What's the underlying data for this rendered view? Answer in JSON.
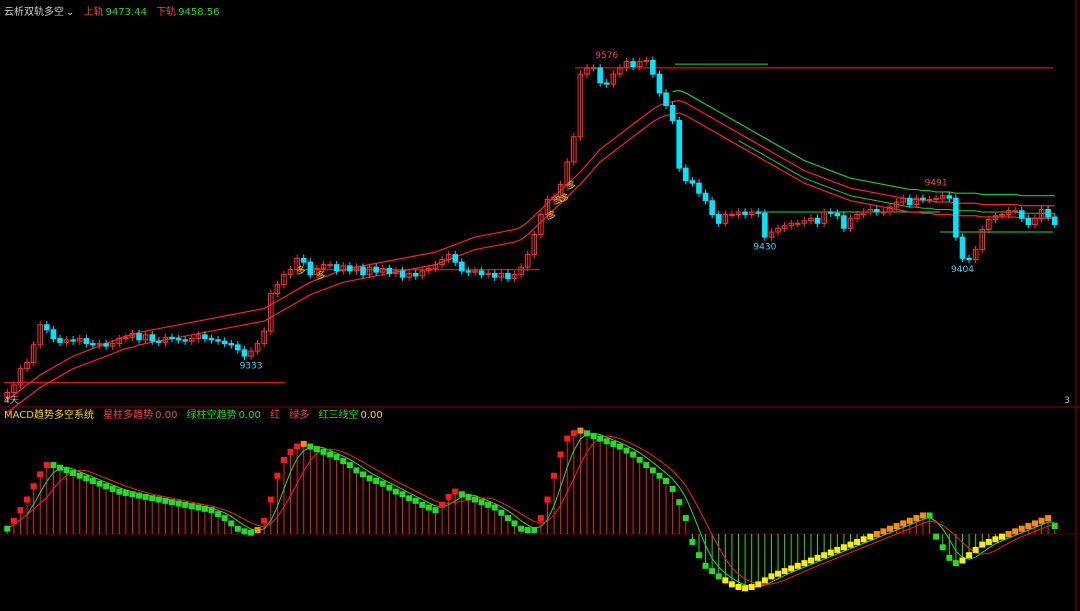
{
  "header": {
    "indicator_name": "云析双轨多空",
    "dropdown_icon": "chevron-down-icon",
    "upper_label": "上轨",
    "upper_value": "9473.44",
    "lower_label": "下轨",
    "lower_value": "9458.56"
  },
  "macd_header": {
    "name": "MACD趋势多空系统",
    "items": [
      {
        "label": "星柱多趋势",
        "value": "0.00"
      },
      {
        "label": "绿柱空趋势",
        "value": "0.00"
      },
      {
        "label": "红",
        "value": ""
      },
      {
        "label": "绿多",
        "value": ""
      },
      {
        "label": "红三线空",
        "value": "0.00"
      }
    ]
  },
  "axis": {
    "left_label": "4天",
    "right_label": "3"
  },
  "colors": {
    "background": "#000000",
    "frame": "#8b0000",
    "up_candle": "#ff3030",
    "down_candle": "#00e5ff",
    "ma_line": "#ff2020",
    "band_line": "#22c822",
    "level_line": "#e01010",
    "green_level": "#22dd22",
    "label_cyan": "#39d3ff",
    "label_red": "#ff4040",
    "signal_yellow": "#ffd700",
    "macd_red": "#ff1a1a",
    "macd_orange": "#ff8c00",
    "macd_yellow": "#ffee00",
    "macd_green": "#22dd22"
  },
  "chart_data": [
    {
      "type": "candlestick",
      "title": "云析双轨多空",
      "x": [
        1,
        2,
        3,
        4,
        5,
        6,
        7,
        8,
        9,
        10,
        11,
        12,
        13,
        14,
        15,
        16,
        17,
        18,
        19,
        20,
        21,
        22,
        23,
        24,
        25,
        26,
        27,
        28,
        29,
        30,
        31,
        32,
        33,
        34,
        35,
        36,
        37,
        38,
        39,
        40,
        41,
        42,
        43,
        44,
        45,
        46,
        47,
        48,
        49,
        50,
        51,
        52,
        53,
        54,
        55,
        56,
        57,
        58,
        59,
        60,
        61,
        62,
        63,
        64,
        65,
        66,
        67,
        68,
        69,
        70,
        71,
        72,
        73,
        74,
        75,
        76,
        77,
        78,
        79,
        80,
        81,
        82,
        83,
        84,
        85,
        86,
        87,
        88,
        89,
        90,
        91,
        92,
        93,
        94,
        95,
        96,
        97,
        98,
        99,
        100,
        101,
        102,
        103,
        104,
        105,
        106,
        107,
        108,
        109,
        110,
        111,
        112,
        113,
        114,
        115,
        116,
        117,
        118,
        119,
        120,
        121,
        122,
        123,
        124,
        125,
        126,
        127,
        128,
        129,
        130,
        131,
        132,
        133,
        134,
        135,
        136,
        137,
        138,
        139,
        140,
        141,
        142,
        143,
        144,
        145,
        146,
        147,
        148,
        149,
        150,
        151,
        152,
        153,
        154,
        155,
        156,
        157,
        158,
        159,
        160
      ],
      "close": [
        9306,
        9312,
        9325,
        9330,
        9344,
        9360,
        9356,
        9349,
        9346,
        9348,
        9347,
        9349,
        9345,
        9344,
        9345,
        9343,
        9345,
        9349,
        9350,
        9353,
        9348,
        9352,
        9347,
        9346,
        9350,
        9349,
        9348,
        9347,
        9349,
        9352,
        9349,
        9348,
        9347,
        9345,
        9344,
        9340,
        9335,
        9339,
        9345,
        9355,
        9385,
        9392,
        9400,
        9404,
        9413,
        9410,
        9400,
        9405,
        9408,
        9408,
        9403,
        9407,
        9403,
        9406,
        9400,
        9406,
        9402,
        9405,
        9401,
        9403,
        9398,
        9401,
        9399,
        9403,
        9405,
        9408,
        9412,
        9416,
        9410,
        9403,
        9402,
        9403,
        9400,
        9401,
        9398,
        9401,
        9397,
        9400,
        9406,
        9416,
        9432,
        9448,
        9460,
        9462,
        9472,
        9490,
        9510,
        9560,
        9565,
        9565,
        9553,
        9552,
        9560,
        9565,
        9570,
        9566,
        9570,
        9571,
        9560,
        9545,
        9535,
        9523,
        9485,
        9475,
        9473,
        9465,
        9459,
        9448,
        9441,
        9448,
        9448,
        9450,
        9448,
        9450,
        9449,
        9430,
        9434,
        9437,
        9439,
        9441,
        9441,
        9443,
        9445,
        9441,
        9450,
        9449,
        9447,
        9437,
        9445,
        9448,
        9450,
        9452,
        9450,
        9450,
        9454,
        9458,
        9461,
        9456,
        9461,
        9460,
        9460,
        9461,
        9463,
        9461,
        9430,
        9413,
        9412,
        9420,
        9436,
        9444,
        9447,
        9448,
        9451,
        9451,
        9445,
        9440,
        9445,
        9452,
        9446,
        9440
      ],
      "ma_line": [
        9290,
        9294,
        9298,
        9302,
        9306,
        9310,
        9313,
        9316,
        9319,
        9322,
        9325,
        9327,
        9329,
        9331,
        9333,
        9335,
        9337,
        9339,
        9341,
        9342,
        9344,
        9345,
        9346,
        9347,
        9348,
        9349,
        9350,
        9351,
        9352,
        9353,
        9354,
        9355,
        9356,
        9357,
        9358,
        9359,
        9360,
        9361,
        9362,
        9363,
        9366,
        9369,
        9372,
        9375,
        9378,
        9381,
        9384,
        9386,
        9388,
        9390,
        9392,
        9394,
        9395,
        9396,
        9397,
        9398,
        9399,
        9400,
        9401,
        9402,
        9403,
        9404,
        9405,
        9406,
        9407,
        9408,
        9410,
        9412,
        9414,
        9416,
        9418,
        9420,
        9421,
        9422,
        9423,
        9424,
        9425,
        9426,
        9428,
        9432,
        9437,
        9442,
        9447,
        9452,
        9457,
        9462,
        9467,
        9472,
        9478,
        9484,
        9490,
        9494,
        9498,
        9502,
        9506,
        9510,
        9514,
        9518,
        9522,
        9525,
        9527,
        9528,
        9529,
        9527,
        9524,
        9521,
        9518,
        9515,
        9512,
        9509,
        9506,
        9503,
        9500,
        9497,
        9494,
        9491,
        9488,
        9485,
        9482,
        9479,
        9476,
        9473,
        9471,
        9469,
        9467,
        9465,
        9463,
        9461,
        9459,
        9458,
        9457,
        9456,
        9455,
        9454,
        9453,
        9452,
        9451,
        9450,
        9450,
        9449,
        9449,
        9448,
        9448,
        9448,
        9447,
        9447,
        9447,
        9447,
        9446,
        9446,
        9446,
        9446,
        9446,
        9446,
        9445,
        9445,
        9445,
        9445,
        9445,
        9445
      ],
      "ylim": [
        9300,
        9600
      ],
      "annotations": [
        {
          "text": "9576",
          "x": 92,
          "kind": "high"
        },
        {
          "text": "9491",
          "x": 142,
          "kind": "high"
        },
        {
          "text": "9333",
          "x": 38,
          "kind": "low"
        },
        {
          "text": "9430",
          "x": 116,
          "kind": "low"
        },
        {
          "text": "9404",
          "x": 146,
          "kind": "low"
        }
      ],
      "signals": [
        {
          "text": "多",
          "x": 44
        },
        {
          "text": "多",
          "x": 47
        },
        {
          "text": "多",
          "x": 82
        },
        {
          "text": "多",
          "x": 83
        },
        {
          "text": "多",
          "x": 84
        },
        {
          "text": "多",
          "x": 85
        }
      ]
    },
    {
      "type": "bar",
      "title": "MACD趋势多空系统",
      "x": [
        1,
        2,
        3,
        4,
        5,
        6,
        7,
        8,
        9,
        10,
        11,
        12,
        13,
        14,
        15,
        16,
        17,
        18,
        19,
        20,
        21,
        22,
        23,
        24,
        25,
        26,
        27,
        28,
        29,
        30,
        31,
        32,
        33,
        34,
        35,
        36,
        37,
        38,
        39,
        40,
        41,
        42,
        43,
        44,
        45,
        46,
        47,
        48,
        49,
        50,
        51,
        52,
        53,
        54,
        55,
        56,
        57,
        58,
        59,
        60,
        61,
        62,
        63,
        64,
        65,
        66,
        67,
        68,
        69,
        70,
        71,
        72,
        73,
        74,
        75,
        76,
        77,
        78,
        79,
        80,
        81,
        82,
        83,
        84,
        85,
        86,
        87,
        88,
        89,
        90,
        91,
        92,
        93,
        94,
        95,
        96,
        97,
        98,
        99,
        100,
        101,
        102,
        103,
        104,
        105,
        106,
        107,
        108,
        109,
        110,
        111,
        112,
        113,
        114,
        115,
        116,
        117,
        118,
        119,
        120,
        121,
        122,
        123,
        124,
        125,
        126,
        127,
        128,
        129,
        130,
        131,
        132,
        133,
        134,
        135,
        136,
        137,
        138,
        139,
        140,
        141,
        142,
        143,
        144,
        145,
        146,
        147,
        148,
        149,
        150,
        151,
        152,
        153,
        154,
        155,
        156,
        157,
        158,
        159,
        160
      ],
      "values": [
        4,
        10,
        18,
        26,
        36,
        45,
        52,
        52,
        50,
        48,
        46,
        44,
        42,
        40,
        38,
        36,
        34,
        32,
        31,
        30,
        29,
        28,
        27,
        26,
        25,
        24,
        23,
        22,
        21,
        20,
        19,
        18,
        15,
        12,
        8,
        4,
        2,
        1,
        3,
        10,
        26,
        44,
        56,
        62,
        66,
        68,
        66,
        64,
        62,
        60,
        58,
        55,
        52,
        48,
        45,
        42,
        40,
        38,
        35,
        32,
        30,
        27,
        25,
        22,
        20,
        18,
        22,
        28,
        32,
        30,
        28,
        26,
        24,
        22,
        20,
        16,
        12,
        8,
        4,
        3,
        3,
        12,
        26,
        44,
        60,
        72,
        76,
        78,
        76,
        74,
        72,
        70,
        68,
        66,
        63,
        60,
        56,
        52,
        48,
        44,
        40,
        34,
        24,
        12,
        -6,
        -16,
        -24,
        -28,
        -32,
        -35,
        -38,
        -40,
        -41,
        -40,
        -38,
        -35,
        -32,
        -30,
        -28,
        -26,
        -24,
        -22,
        -20,
        -18,
        -16,
        -14,
        -12,
        -10,
        -8,
        -6,
        -4,
        -2,
        0,
        2,
        4,
        6,
        8,
        10,
        12,
        14,
        14,
        -2,
        -10,
        -18,
        -22,
        -20,
        -16,
        -12,
        -8,
        -6,
        -4,
        -2,
        0,
        2,
        4,
        6,
        8,
        10,
        12,
        6
      ]
    }
  ]
}
